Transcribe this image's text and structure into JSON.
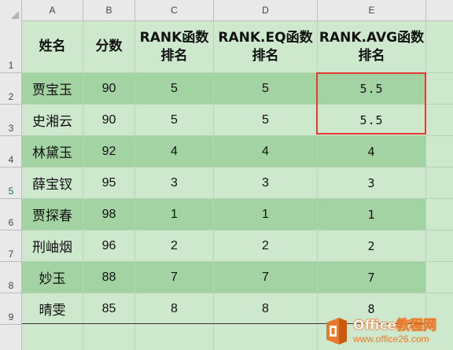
{
  "columns": [
    "A",
    "B",
    "C",
    "D",
    "E"
  ],
  "rows": [
    "1",
    "2",
    "3",
    "4",
    "5",
    "6",
    "7",
    "8",
    "9"
  ],
  "selected_row": "5",
  "headers": {
    "name": "姓名",
    "score": "分数",
    "rank_line1": "RANK函数",
    "rank_line2": "排名",
    "rank_eq_line1": "RANK.EQ函数",
    "rank_eq_line2": "排名",
    "rank_avg_line1": "RANK.AVG函数",
    "rank_avg_line2": "排名"
  },
  "records": [
    {
      "name": "贾宝玉",
      "score": "90",
      "rank": "5",
      "rank_eq": "5",
      "rank_avg": "5.5"
    },
    {
      "name": "史湘云",
      "score": "90",
      "rank": "5",
      "rank_eq": "5",
      "rank_avg": "5.5"
    },
    {
      "name": "林黛玉",
      "score": "92",
      "rank": "4",
      "rank_eq": "4",
      "rank_avg": "4"
    },
    {
      "name": "薛宝钗",
      "score": "95",
      "rank": "3",
      "rank_eq": "3",
      "rank_avg": "3"
    },
    {
      "name": "贾探春",
      "score": "98",
      "rank": "1",
      "rank_eq": "1",
      "rank_avg": "1"
    },
    {
      "name": "刑岫烟",
      "score": "96",
      "rank": "2",
      "rank_eq": "2",
      "rank_avg": "2"
    },
    {
      "name": "妙玉",
      "score": "88",
      "rank": "7",
      "rank_eq": "7",
      "rank_avg": "7"
    },
    {
      "name": "晴雯",
      "score": "85",
      "rank": "8",
      "rank_eq": "8",
      "rank_avg": "8"
    }
  ],
  "watermark": {
    "title": "Office教程网",
    "url": "www.office26.com"
  },
  "colors": {
    "highlight": "#e53935",
    "band_dark": "#a3d3a3",
    "band_light": "#cde8cd",
    "logo_orange": "#e87a2a"
  }
}
